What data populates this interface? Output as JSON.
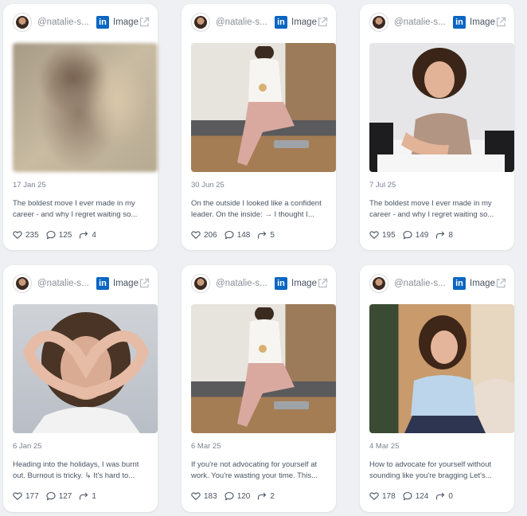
{
  "cards": [
    {
      "handle": "@natalie-s...",
      "type": "Image",
      "date": "17 Jan 25",
      "caption": "The boldest move I ever made in my career - and why I regret waiting so...",
      "likes": "235",
      "comments": "125",
      "shares": "4"
    },
    {
      "handle": "@natalie-s...",
      "type": "Image",
      "date": "30 Jun 25",
      "caption": "On the outside I looked like a confident leader. On the inside: → I thought I...",
      "likes": "206",
      "comments": "148",
      "shares": "5"
    },
    {
      "handle": "@natalie-s...",
      "type": "Image",
      "date": "7 Jul 25",
      "caption": "The boldest move I ever made in my career - and why I regret waiting so...",
      "likes": "195",
      "comments": "149",
      "shares": "8"
    },
    {
      "handle": "@natalie-s...",
      "type": "Image",
      "date": "6 Jan 25",
      "caption": "Heading into the holidays, I was burnt out. Burnout is tricky. ↳ It's hard to...",
      "likes": "177",
      "comments": "127",
      "shares": "1"
    },
    {
      "handle": "@natalie-s...",
      "type": "Image",
      "date": "6 Mar 25",
      "caption": "If you're not advocating for yourself at work. You're wasting your time. This...",
      "likes": "183",
      "comments": "120",
      "shares": "2"
    },
    {
      "handle": "@natalie-s...",
      "type": "Image",
      "date": "4 Mar 25",
      "caption": "How to advocate for yourself without sounding like you're bragging Let's...",
      "likes": "178",
      "comments": "124",
      "shares": "0"
    }
  ],
  "colors": {
    "linkedin": "#0a66c2",
    "card_bg": "#ffffff",
    "page_bg": "#eef0f3",
    "text_muted": "#7b8290"
  },
  "icons": [
    "linkedin-icon",
    "external-link-icon",
    "heart-icon",
    "comment-icon",
    "share-icon"
  ]
}
